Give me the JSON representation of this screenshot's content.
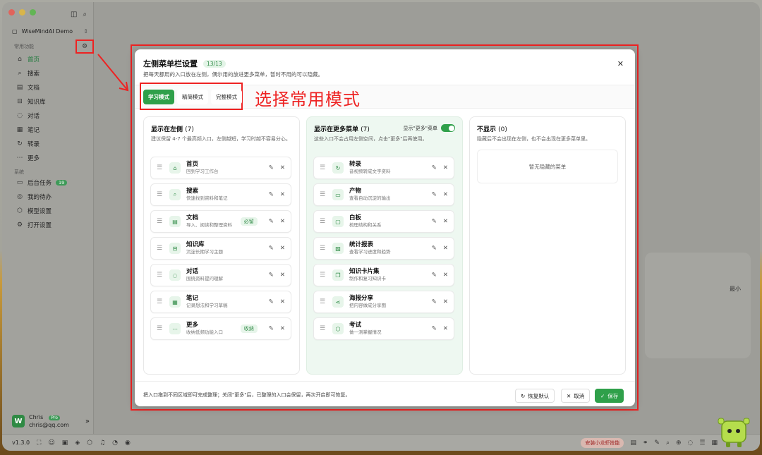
{
  "sidebar": {
    "workspace": "WiseMindAI Demo",
    "section_common": "常用功能",
    "section_system": "系统",
    "common_items": [
      {
        "label": "首页",
        "icon": "home-icon"
      },
      {
        "label": "搜索",
        "icon": "search-icon"
      },
      {
        "label": "文档",
        "icon": "document-icon"
      },
      {
        "label": "知识库",
        "icon": "book-icon"
      },
      {
        "label": "对话",
        "icon": "chat-icon"
      },
      {
        "label": "笔记",
        "icon": "note-icon"
      },
      {
        "label": "转录",
        "icon": "transcribe-icon"
      },
      {
        "label": "更多",
        "icon": "more-icon"
      }
    ],
    "system_items": [
      {
        "label": "后台任务",
        "badge": "19"
      },
      {
        "label": "我的待办"
      },
      {
        "label": "模型设置"
      },
      {
        "label": "打开设置"
      }
    ],
    "user": {
      "name": "Chris",
      "email": "chris@qq.com",
      "plan": "Pro"
    }
  },
  "status_bar": {
    "version": "v1.3.0",
    "promo": "安装小龙虾技能"
  },
  "annotation": {
    "text": "选择常用模式"
  },
  "modal": {
    "title": "左侧菜单栏设置",
    "count": "13/13",
    "subtitle": "把每天都用的入口放在左侧，偶尔用的放进更多菜单，暂时不用的可以隐藏。",
    "modes": [
      "学习模式",
      "精简模式",
      "完整模式"
    ],
    "active_mode": "学习模式",
    "left_col": {
      "title": "显示在左侧",
      "count": "(7)",
      "desc": "建议保留 4-7 个最高频入口，左侧越短，学习时越不容易分心。",
      "items": [
        {
          "name": "首页",
          "desc": "回到学习工作台",
          "tag": ""
        },
        {
          "name": "搜索",
          "desc": "快速找到资料和笔记",
          "tag": ""
        },
        {
          "name": "文档",
          "desc": "导入、阅读和整理资料",
          "tag": "必留"
        },
        {
          "name": "知识库",
          "desc": "沉淀长期学习主题",
          "tag": ""
        },
        {
          "name": "对话",
          "desc": "围绕资料提问理解",
          "tag": ""
        },
        {
          "name": "笔记",
          "desc": "记录想法和学习草稿",
          "tag": ""
        },
        {
          "name": "更多",
          "desc": "收纳低频功能入口",
          "tag": "收纳"
        }
      ]
    },
    "mid_col": {
      "title": "显示在更多菜单",
      "count": "(7)",
      "toggle_label": "显示\"更多\"菜单",
      "toggle_on": true,
      "desc": "这些入口不会占用左侧空间，点击\"更多\"后再使用。",
      "items": [
        {
          "name": "转录",
          "desc": "音视频转成文字资料"
        },
        {
          "name": "产物",
          "desc": "查看自动沉淀的输出"
        },
        {
          "name": "白板",
          "desc": "梳理结构和关系"
        },
        {
          "name": "统计报表",
          "desc": "查看学习进度和趋势"
        },
        {
          "name": "知识卡片集",
          "desc": "制作和复习知识卡"
        },
        {
          "name": "海报分享",
          "desc": "把内容做成分享图"
        },
        {
          "name": "考试",
          "desc": "做一测掌握情况"
        }
      ]
    },
    "right_col": {
      "title": "不显示",
      "count": "(0)",
      "desc": "隐藏后不会出现在左侧，也不会出现在更多菜单里。",
      "empty": "暂无隐藏的菜单"
    },
    "footer_note": "把入口拖到不同区域即可完成整理；关闭\"更多\"后，已整理的入口会保留，再次开启即可恢复。",
    "buttons": {
      "reset": "恢复默认",
      "cancel": "取消",
      "save": "保存"
    }
  },
  "colors": {
    "accent": "#2fa04a",
    "annotation": "#e22222"
  }
}
